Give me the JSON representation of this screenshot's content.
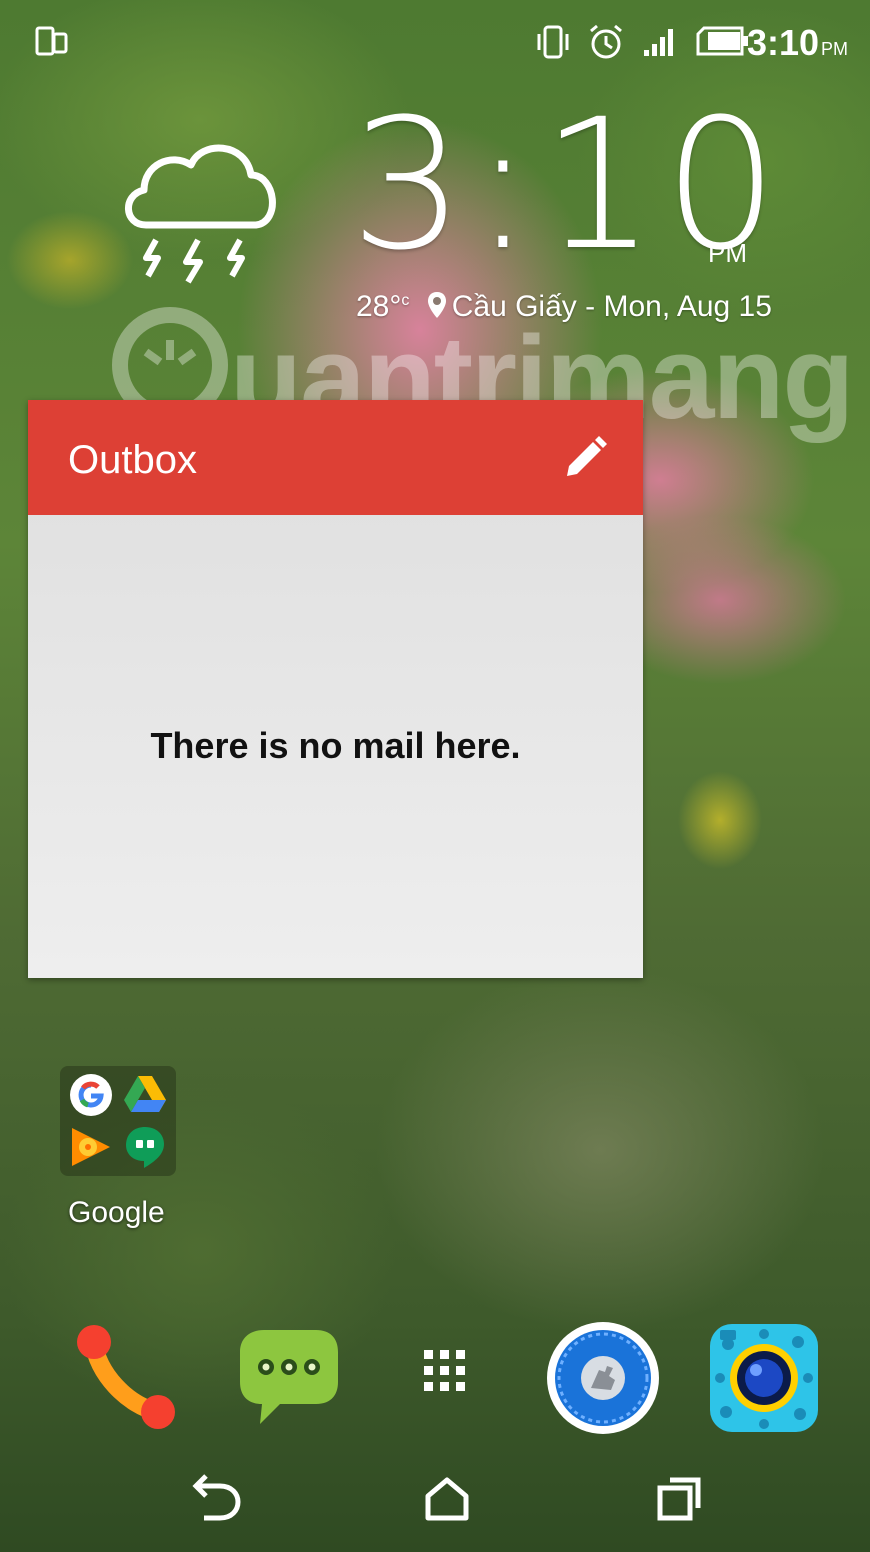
{
  "status_bar": {
    "time": "3:10",
    "ampm": "PM",
    "icons": [
      "screen-mirror-icon",
      "vibrate-icon",
      "alarm-icon",
      "signal-icon",
      "battery-icon"
    ]
  },
  "clock_widget": {
    "time": "3:10",
    "ampm": "PM",
    "temperature": "28°",
    "temperature_unit": "c",
    "location": "Cầu Giấy",
    "date": "Mon, Aug 15",
    "weather_icon": "thunderstorm-icon"
  },
  "watermark": {
    "text": "uantrimang"
  },
  "outbox_widget": {
    "title": "Outbox",
    "empty_message": "There is no mail here.",
    "header_color": "#dd4035"
  },
  "google_folder": {
    "label": "Google",
    "apps": [
      "google-search-icon",
      "google-drive-icon",
      "google-play-music-icon",
      "hangouts-icon"
    ]
  },
  "dock": {
    "apps": [
      "phone-icon",
      "messaging-icon",
      "app-drawer-icon",
      "clean-master-icon",
      "camera-icon"
    ]
  },
  "nav_bar": {
    "buttons": [
      "back-icon",
      "home-icon",
      "recents-icon"
    ]
  }
}
